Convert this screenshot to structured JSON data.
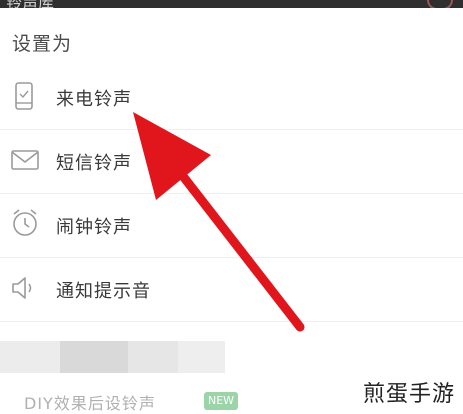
{
  "status_bar": {
    "partial_title": "铃声库"
  },
  "sheet": {
    "title": "设置为",
    "options": [
      {
        "label": "来电铃声",
        "icon": "phone-icon"
      },
      {
        "label": "短信铃声",
        "icon": "envelope-icon"
      },
      {
        "label": "闹钟铃声",
        "icon": "alarm-clock-icon"
      },
      {
        "label": "通知提示音",
        "icon": "speaker-icon"
      }
    ],
    "diy_row": {
      "label": "DIY效果后设铃声",
      "badge": "NEW"
    }
  },
  "annotation": {
    "color": "#e0161c"
  },
  "watermark": "煎蛋手游"
}
